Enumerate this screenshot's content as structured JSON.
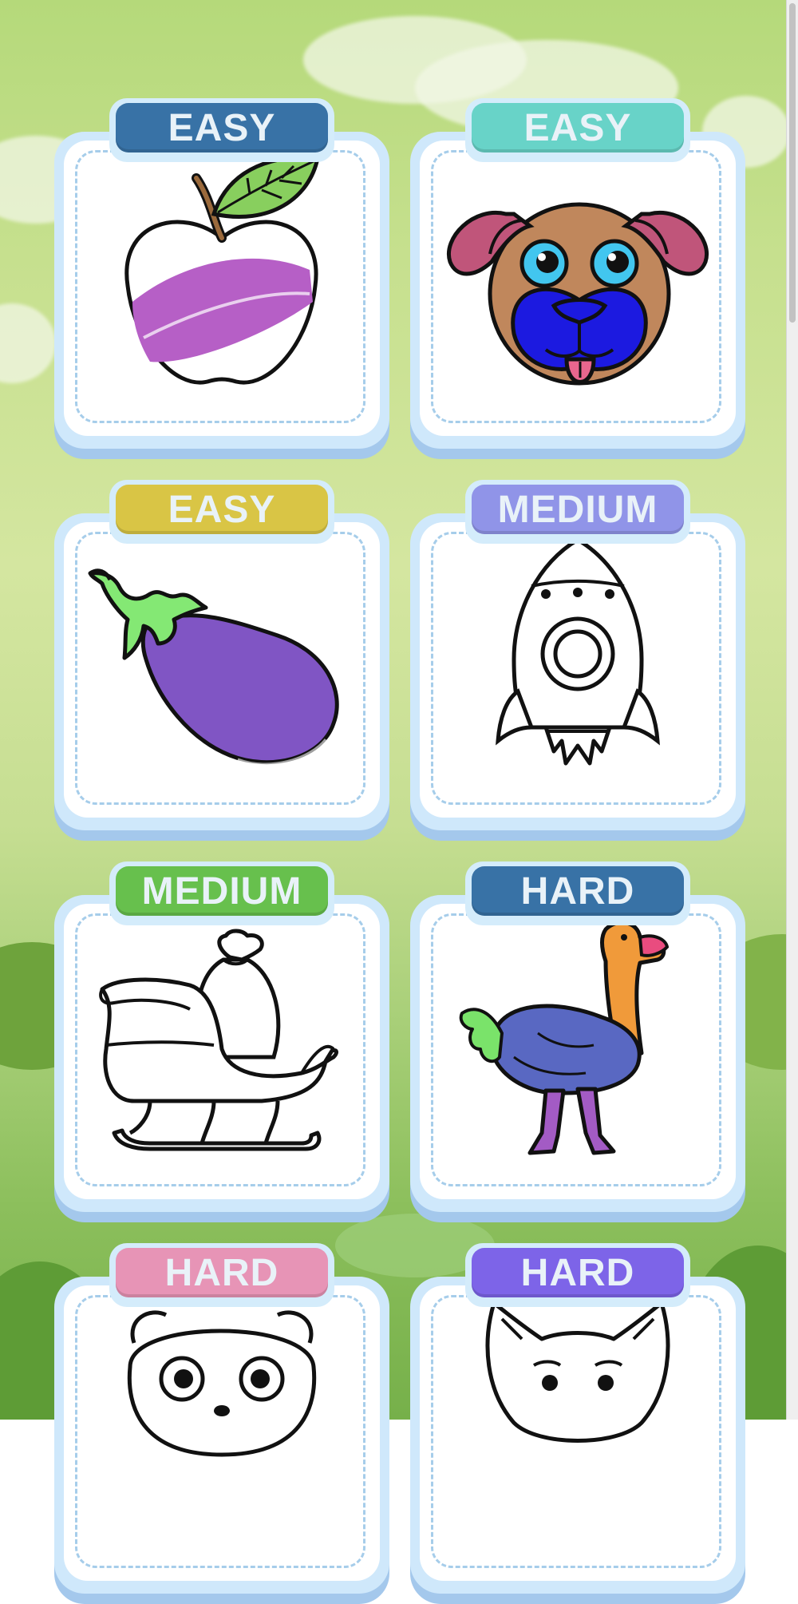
{
  "levels": [
    {
      "difficulty": "EASY",
      "color": "#3872a6",
      "drawing": "apple"
    },
    {
      "difficulty": "EASY",
      "color": "#68d3c8",
      "drawing": "puppy"
    },
    {
      "difficulty": "EASY",
      "color": "#d9c545",
      "drawing": "eggplant"
    },
    {
      "difficulty": "MEDIUM",
      "color": "#9094e8",
      "drawing": "rocket"
    },
    {
      "difficulty": "MEDIUM",
      "color": "#67c04d",
      "drawing": "sleigh"
    },
    {
      "difficulty": "HARD",
      "color": "#3872a6",
      "drawing": "ostrich"
    },
    {
      "difficulty": "HARD",
      "color": "#e794b6",
      "drawing": "panda"
    },
    {
      "difficulty": "HARD",
      "color": "#7d64e8",
      "drawing": "fox"
    }
  ]
}
